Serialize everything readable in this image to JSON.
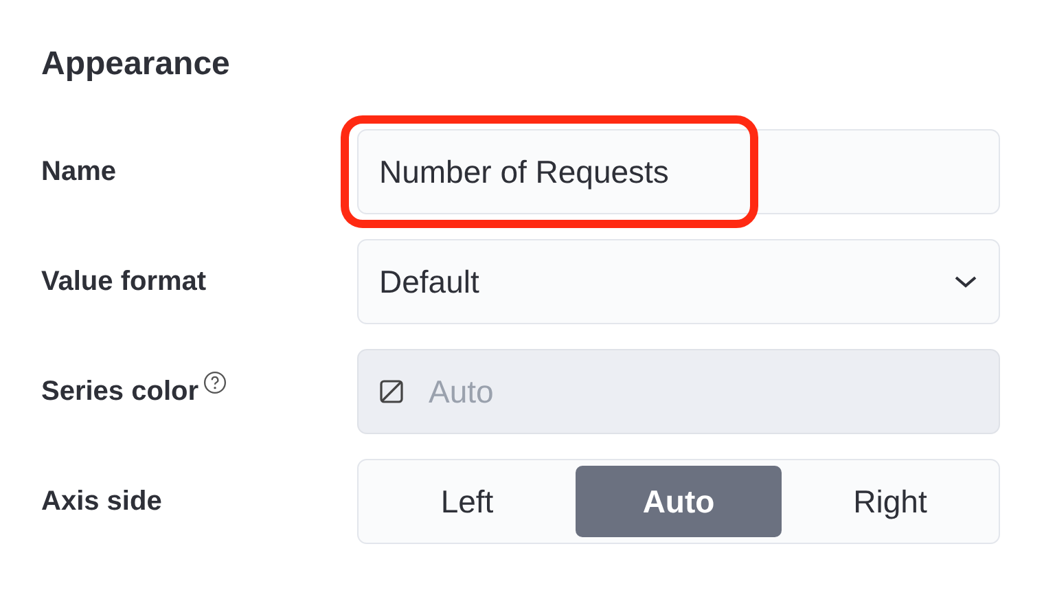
{
  "section": {
    "title": "Appearance"
  },
  "fields": [
    {
      "kind": "text",
      "label": "Name",
      "value": "Number of Requests",
      "highlighted": true
    },
    {
      "kind": "select",
      "label": "Value format",
      "value": "Default"
    },
    {
      "kind": "color",
      "label": "Series color",
      "help": true,
      "placeholder": "Auto",
      "disabled": true
    },
    {
      "kind": "segmented",
      "label": "Axis side",
      "options": [
        {
          "label": "Left",
          "selected": false
        },
        {
          "label": "Auto",
          "selected": true
        },
        {
          "label": "Right",
          "selected": false
        }
      ]
    }
  ]
}
